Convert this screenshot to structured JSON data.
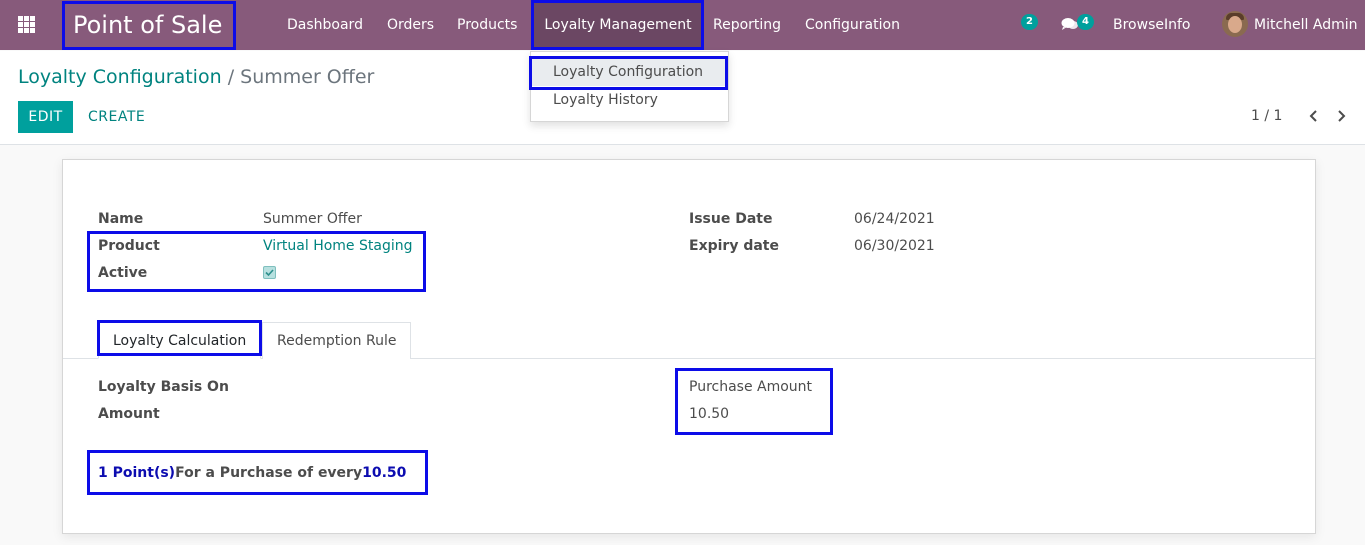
{
  "navbar": {
    "brand": "Point of Sale",
    "menu": [
      "Dashboard",
      "Orders",
      "Products",
      "Loyalty Management",
      "Reporting",
      "Configuration"
    ],
    "activity_count": "2",
    "message_count": "4",
    "company": "BrowseInfo",
    "user": "Mitchell Admin"
  },
  "dropdown": {
    "items": [
      "Loyalty Configuration",
      "Loyalty History"
    ]
  },
  "breadcrumb": {
    "parent": "Loyalty Configuration",
    "separator": "/",
    "current": "Summer Offer"
  },
  "actions": {
    "edit": "EDIT",
    "create": "CREATE"
  },
  "pager": {
    "value": "1 / 1"
  },
  "form": {
    "name_label": "Name",
    "name_value": "Summer Offer",
    "product_label": "Product",
    "product_value": "Virtual Home Staging",
    "active_label": "Active",
    "active_checked": true,
    "issue_date_label": "Issue Date",
    "issue_date_value": "06/24/2021",
    "expiry_date_label": "Expiry date",
    "expiry_date_value": "06/30/2021"
  },
  "tabs": [
    "Loyalty Calculation",
    "Redemption Rule"
  ],
  "calculation": {
    "basis_label": "Loyalty Basis On",
    "basis_value": "Purchase Amount",
    "amount_label": "Amount",
    "amount_value": "10.50",
    "summary_points": "1 Point(s)",
    "summary_text": "For a Purchase of every",
    "summary_amount": "10.50"
  },
  "colors": {
    "navbar": "#875a7b",
    "accent": "#00a09d",
    "link": "#00837f",
    "highlight_box": "#0c0ce8"
  }
}
